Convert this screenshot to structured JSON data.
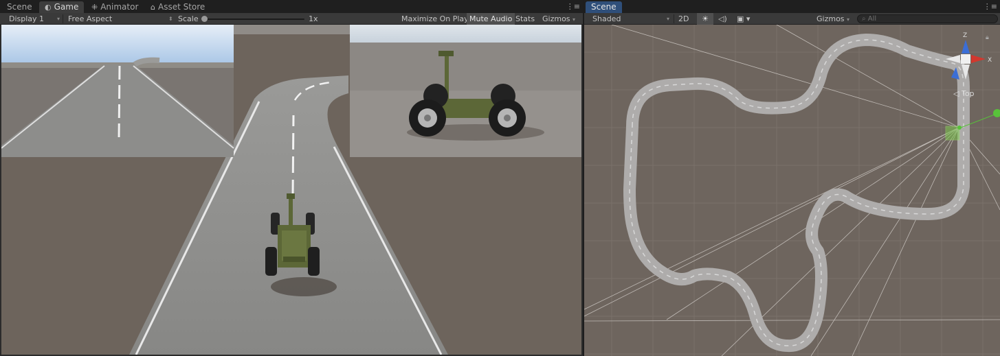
{
  "game_panel": {
    "tabs": [
      {
        "label": "Scene"
      },
      {
        "label": "Game"
      },
      {
        "label": "Animator"
      },
      {
        "label": "Asset Store"
      }
    ],
    "display": "Display 1",
    "aspect": "Free Aspect",
    "scale_label": "Scale",
    "scale_value": "1x",
    "maximize_on_play": "Maximize On Play",
    "mute_audio": "Mute Audio",
    "stats": "Stats",
    "gizmos": "Gizmos"
  },
  "scene_panel": {
    "tab": "Scene",
    "shading_mode": "Shaded",
    "mode_2d": "2D",
    "gizmos": "Gizmos",
    "search_placeholder": "All",
    "orientation_label": "Top",
    "axis_z": "Z",
    "axis_x": "X"
  },
  "icons": [
    "game-tab-icon",
    "animator-tab-icon",
    "asset-store-tab-icon",
    "menu-icon",
    "lighting-icon",
    "audio-icon",
    "effects-icon",
    "search-icon",
    "lock-icon",
    "scene-gizmo"
  ],
  "colors": {
    "tab_bar": "#1f1f1f",
    "toolbar": "#3a3a3a",
    "ground": "#6d645c",
    "road": "#8b8b88",
    "vehicle": "#5c6737",
    "gizmo_x": "#d2382e",
    "gizmo_y": "#58c23a",
    "gizmo_z": "#3b6ed6"
  }
}
